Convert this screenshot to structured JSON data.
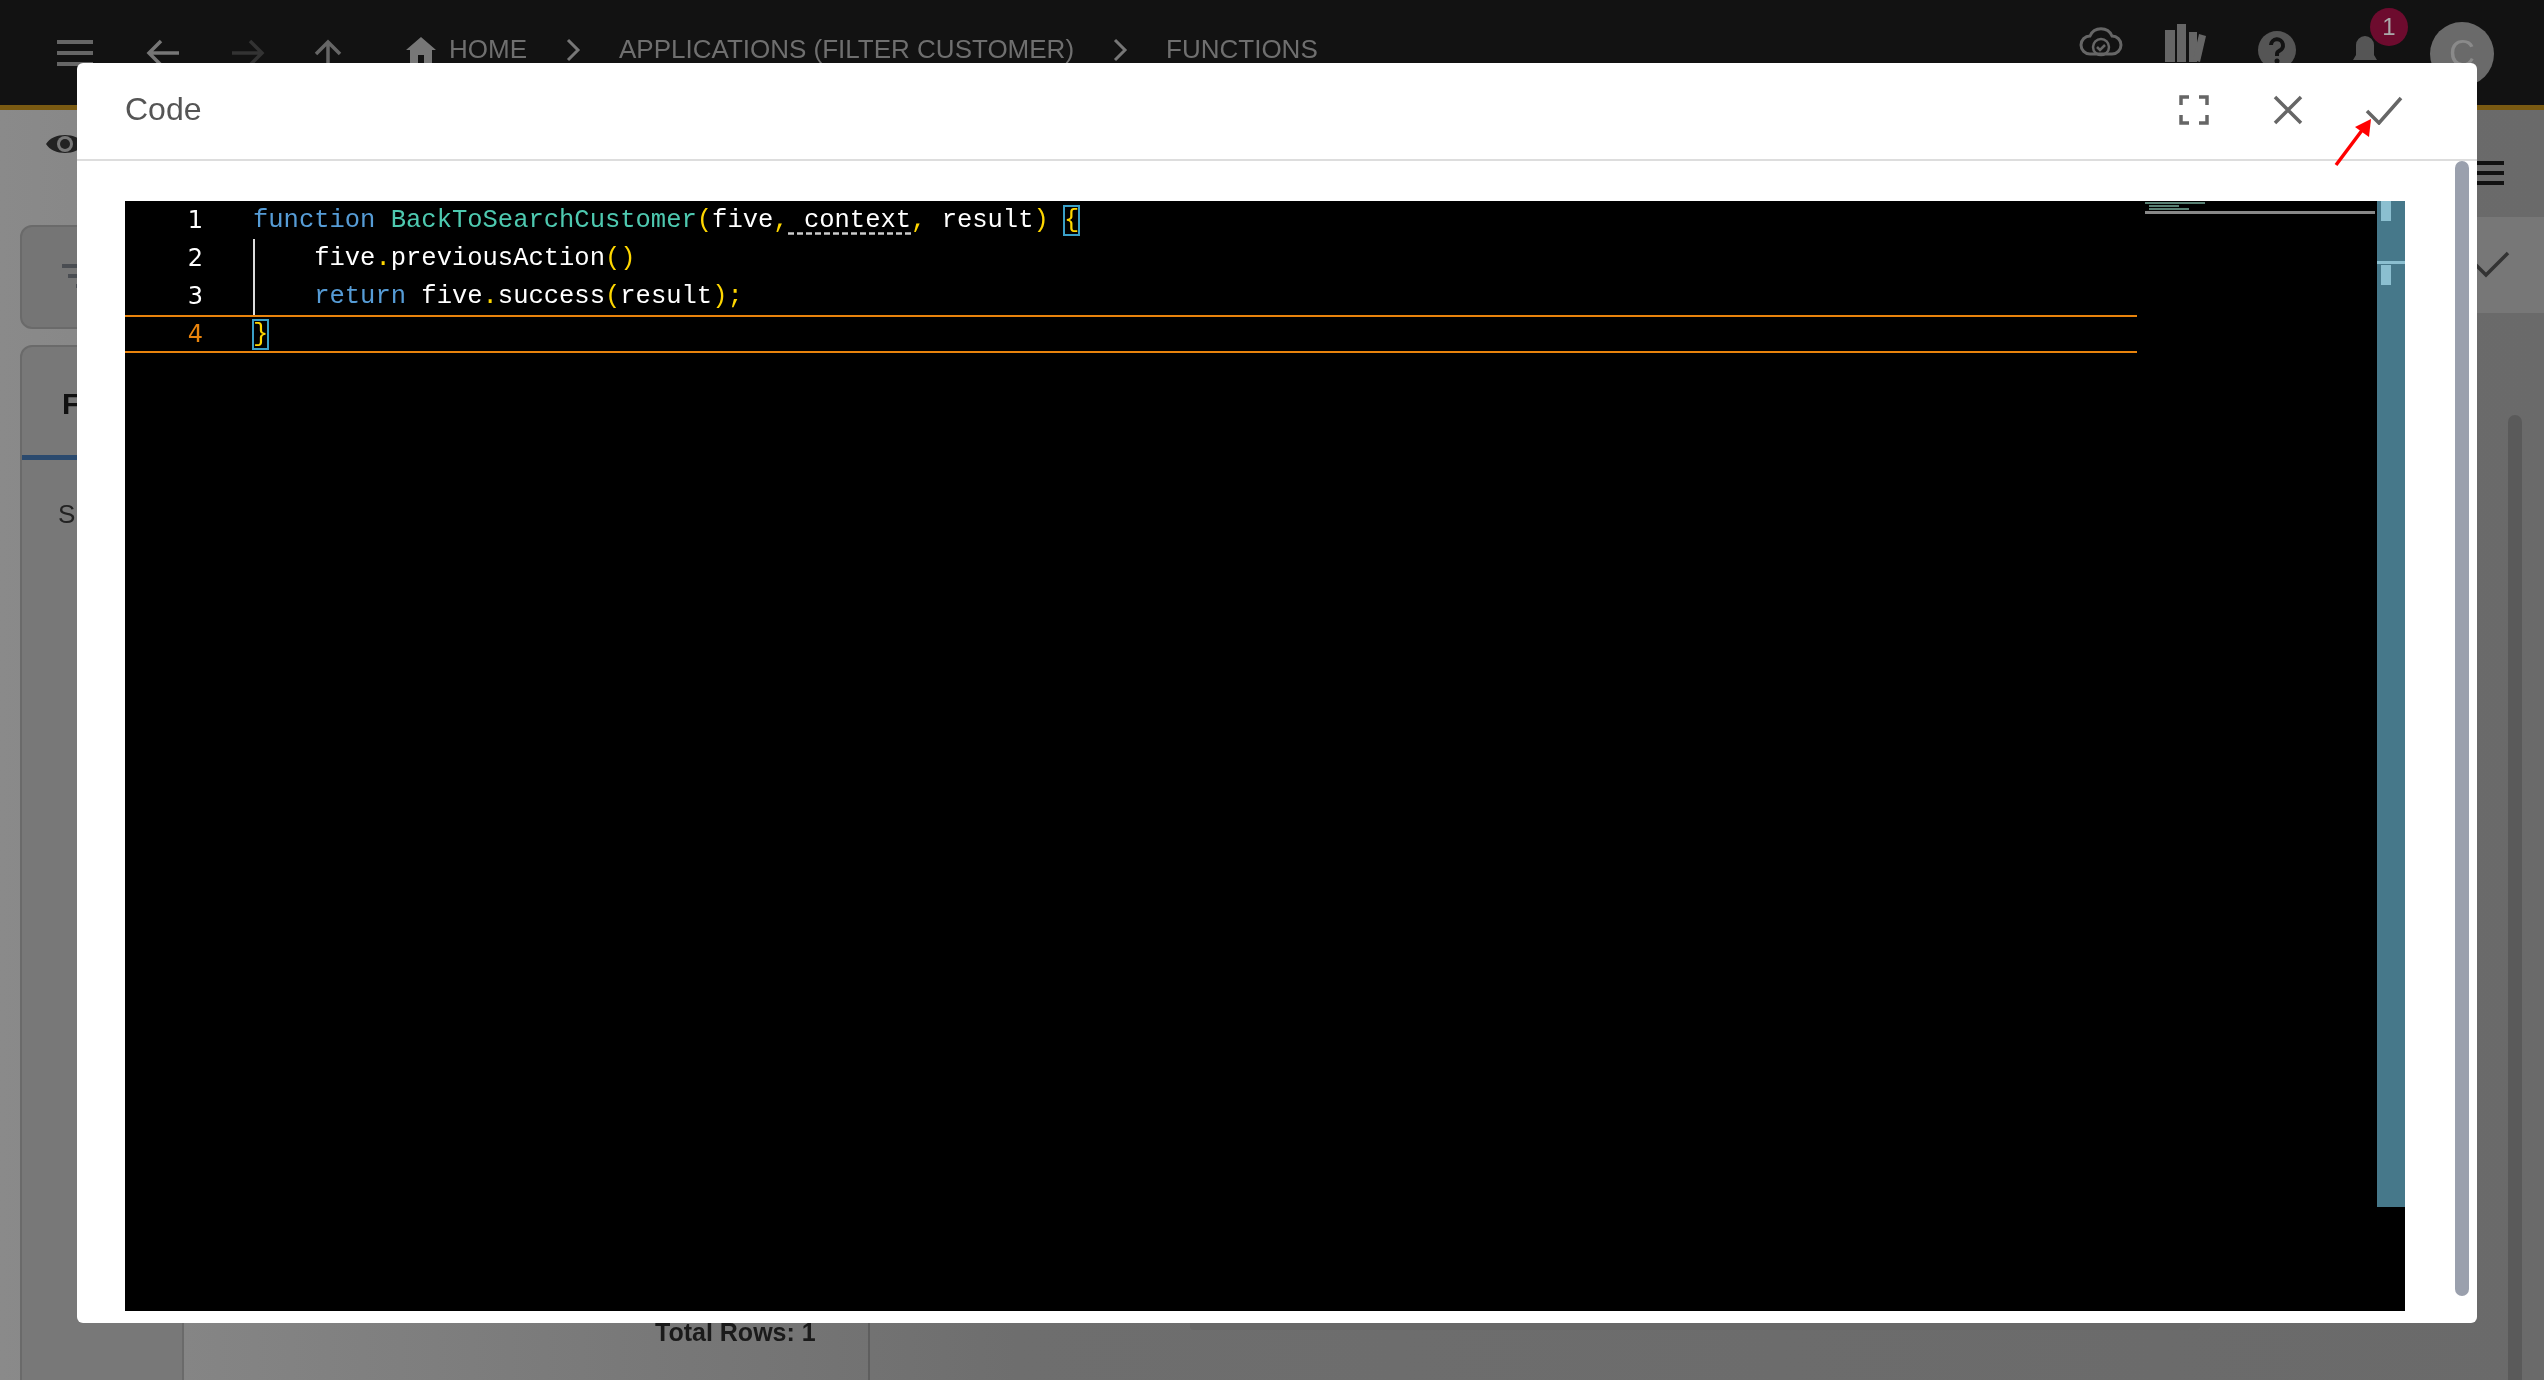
{
  "topbar": {
    "breadcrumbs": [
      {
        "label": "HOME",
        "kind": "home"
      },
      {
        "label": "APPLICATIONS (FILTER CUSTOMER)",
        "kind": "page"
      },
      {
        "label": "FUNCTIONS",
        "kind": "page"
      }
    ],
    "notification_count": "1",
    "avatar_initial": "C"
  },
  "background": {
    "tab_label": "F",
    "row_text": "S",
    "total_rows": "Total Rows: 1"
  },
  "dialog": {
    "title": "Code",
    "editor": {
      "lines": [
        {
          "number": "1",
          "current": false,
          "tokens": [
            {
              "text": "function",
              "kind": "keyword"
            },
            {
              "text": " BackToSearchCustomer",
              "kind": "type"
            },
            {
              "text": "(",
              "kind": "punct"
            },
            {
              "text": "five",
              "kind": "plain"
            },
            {
              "text": ",",
              "kind": "punct"
            },
            {
              "text": " context",
              "kind": "warn"
            },
            {
              "text": ",",
              "kind": "punct"
            },
            {
              "text": " result",
              "kind": "plain"
            },
            {
              "text": ") ",
              "kind": "punct"
            },
            {
              "text": "{",
              "kind": "match"
            }
          ]
        },
        {
          "number": "2",
          "current": false,
          "tokens": [
            {
              "text": "    five",
              "kind": "plain"
            },
            {
              "text": ".",
              "kind": "punct"
            },
            {
              "text": "previousAction",
              "kind": "plain"
            },
            {
              "text": "()",
              "kind": "punct"
            }
          ]
        },
        {
          "number": "3",
          "current": false,
          "tokens": [
            {
              "text": "    return",
              "kind": "keyword"
            },
            {
              "text": " five",
              "kind": "plain"
            },
            {
              "text": ".",
              "kind": "punct"
            },
            {
              "text": "success",
              "kind": "plain"
            },
            {
              "text": "(",
              "kind": "punct"
            },
            {
              "text": "result",
              "kind": "plain"
            },
            {
              "text": ");",
              "kind": "punct"
            }
          ]
        },
        {
          "number": "4",
          "current": true,
          "tokens": [
            {
              "text": "}",
              "kind": "match"
            }
          ]
        }
      ]
    }
  }
}
